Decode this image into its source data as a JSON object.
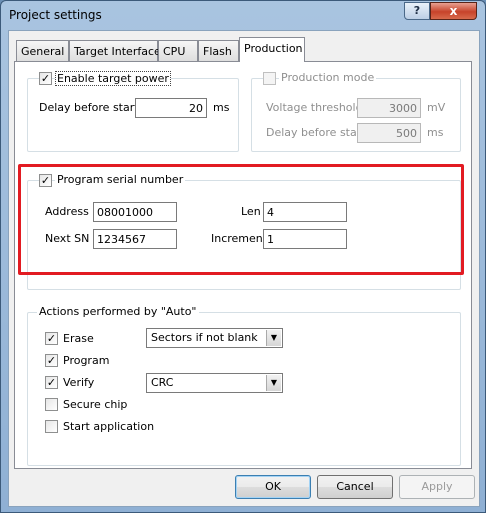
{
  "window": {
    "title": "Project settings",
    "help_label": "?",
    "close_label": "x"
  },
  "tabs": [
    {
      "label": "General",
      "active": false
    },
    {
      "label": "Target Interface",
      "active": false
    },
    {
      "label": "CPU",
      "active": false
    },
    {
      "label": "Flash",
      "active": false
    },
    {
      "label": "Production",
      "active": true
    }
  ],
  "target_power": {
    "enable_label": "Enable target power",
    "enabled": true,
    "delay_label": "Delay before start",
    "delay_value": "20",
    "delay_unit": "ms"
  },
  "production_mode": {
    "label": "Production mode",
    "enabled": false,
    "voltage_label": "Voltage threshold",
    "voltage_value": "3000",
    "voltage_unit": "mV",
    "delay_label": "Delay before start",
    "delay_value": "500",
    "delay_unit": "ms"
  },
  "serial_number": {
    "label": "Program serial number",
    "enabled": true,
    "address_label": "Address",
    "address_value": "08001000",
    "len_label": "Len",
    "len_value": "4",
    "next_sn_label": "Next SN",
    "next_sn_value": "1234567",
    "increment_label": "Increment",
    "increment_value": "1"
  },
  "auto_actions": {
    "label": "Actions performed by \"Auto\"",
    "erase_label": "Erase",
    "erase_checked": true,
    "erase_mode": "Sectors if not blank",
    "program_label": "Program",
    "program_checked": true,
    "verify_label": "Verify",
    "verify_checked": true,
    "verify_mode": "CRC",
    "secure_label": "Secure chip",
    "secure_checked": false,
    "start_label": "Start application",
    "start_checked": false
  },
  "buttons": {
    "ok": "OK",
    "cancel": "Cancel",
    "apply": "Apply"
  },
  "icons": {
    "check": "check-icon",
    "dropdown": "chevron-down-icon",
    "close": "close-icon"
  },
  "colors": {
    "highlight": "#e21b22",
    "title_bar": "#a9c4e0",
    "close_button": "#c7432a"
  }
}
